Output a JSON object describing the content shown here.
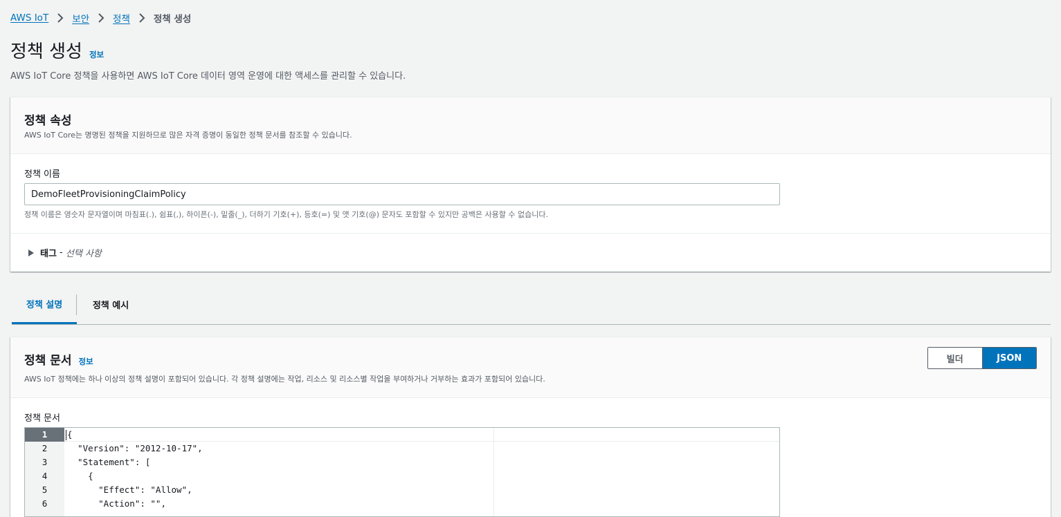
{
  "breadcrumb": {
    "items": [
      "AWS IoT",
      "보안",
      "정책"
    ],
    "current": "정책 생성"
  },
  "page": {
    "title": "정책 생성",
    "info_label": "정보",
    "description": "AWS IoT Core 정책을 사용하면 AWS IoT Core 데이터 영역 운영에 대한 액세스를 관리할 수 있습니다."
  },
  "policy_properties": {
    "title": "정책 속성",
    "description": "AWS IoT Core는 명명된 정책을 지원하므로 많은 자격 증명이 동일한 정책 문서를 참조할 수 있습니다.",
    "name_label": "정책 이름",
    "name_value": "DemoFleetProvisioningClaimPolicy",
    "name_hint": "정책 이름은 영숫자 문자열이며 마침표(.), 쉼표(,), 하이픈(-), 밑줄(_), 더하기 기호(+), 등호(=) 및 앳 기호(@) 문자도 포함할 수 있지만 공백은 사용할 수 없습니다.",
    "tags_label": "태그",
    "tags_separator": " - ",
    "tags_optional": "선택 사항"
  },
  "tabs": [
    {
      "label": "정책 설명",
      "active": true
    },
    {
      "label": "정책 예시",
      "active": false
    }
  ],
  "policy_document": {
    "title": "정책 문서",
    "info_label": "정보",
    "description": "AWS IoT 정책에는 하나 이상의 정책 설명이 포함되어 있습니다. 각 정책 설명에는 작업, 리소스 및 리소스별 작업을 부여하거나 거부하는 효과가 포함되어 있습니다.",
    "mode_options": [
      "빌더",
      "JSON"
    ],
    "selected_mode": "JSON",
    "editor_label": "정책 문서",
    "code_lines": [
      "{",
      "  \"Version\": \"2012-10-17\",",
      "  \"Statement\": [",
      "    {",
      "      \"Effect\": \"Allow\",",
      "      \"Action\": \"\","
    ],
    "line_numbers": [
      "1",
      "2",
      "3",
      "4",
      "5",
      "6"
    ]
  },
  "colors": {
    "accent": "#0073bb",
    "background": "#f2f3f3",
    "text": "#16191f",
    "muted": "#545b64"
  }
}
